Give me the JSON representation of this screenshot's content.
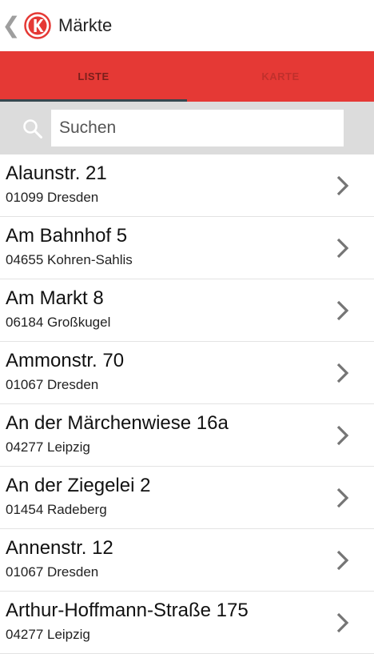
{
  "header": {
    "back_glyph": "❮",
    "title": "Märkte"
  },
  "tabs": [
    {
      "label": "LISTE",
      "active": true
    },
    {
      "label": "KARTE",
      "active": false
    }
  ],
  "search": {
    "placeholder": "Suchen",
    "value": ""
  },
  "colors": {
    "accent": "#e53935",
    "indicator": "#37474f",
    "search_bg": "#dcdcdc"
  },
  "markets": [
    {
      "street": "Alaunstr. 21",
      "city": "01099 Dresden"
    },
    {
      "street": "Am Bahnhof 5",
      "city": "04655 Kohren-Sahlis"
    },
    {
      "street": "Am Markt 8",
      "city": "06184 Großkugel"
    },
    {
      "street": "Ammonstr. 70",
      "city": "01067 Dresden"
    },
    {
      "street": "An der Märchenwiese 16a",
      "city": "04277 Leipzig"
    },
    {
      "street": "An der Ziegelei 2",
      "city": "01454 Radeberg"
    },
    {
      "street": "Annenstr. 12",
      "city": "01067 Dresden"
    },
    {
      "street": "Arthur-Hoffmann-Straße 175",
      "city": "04277 Leipzig"
    }
  ]
}
